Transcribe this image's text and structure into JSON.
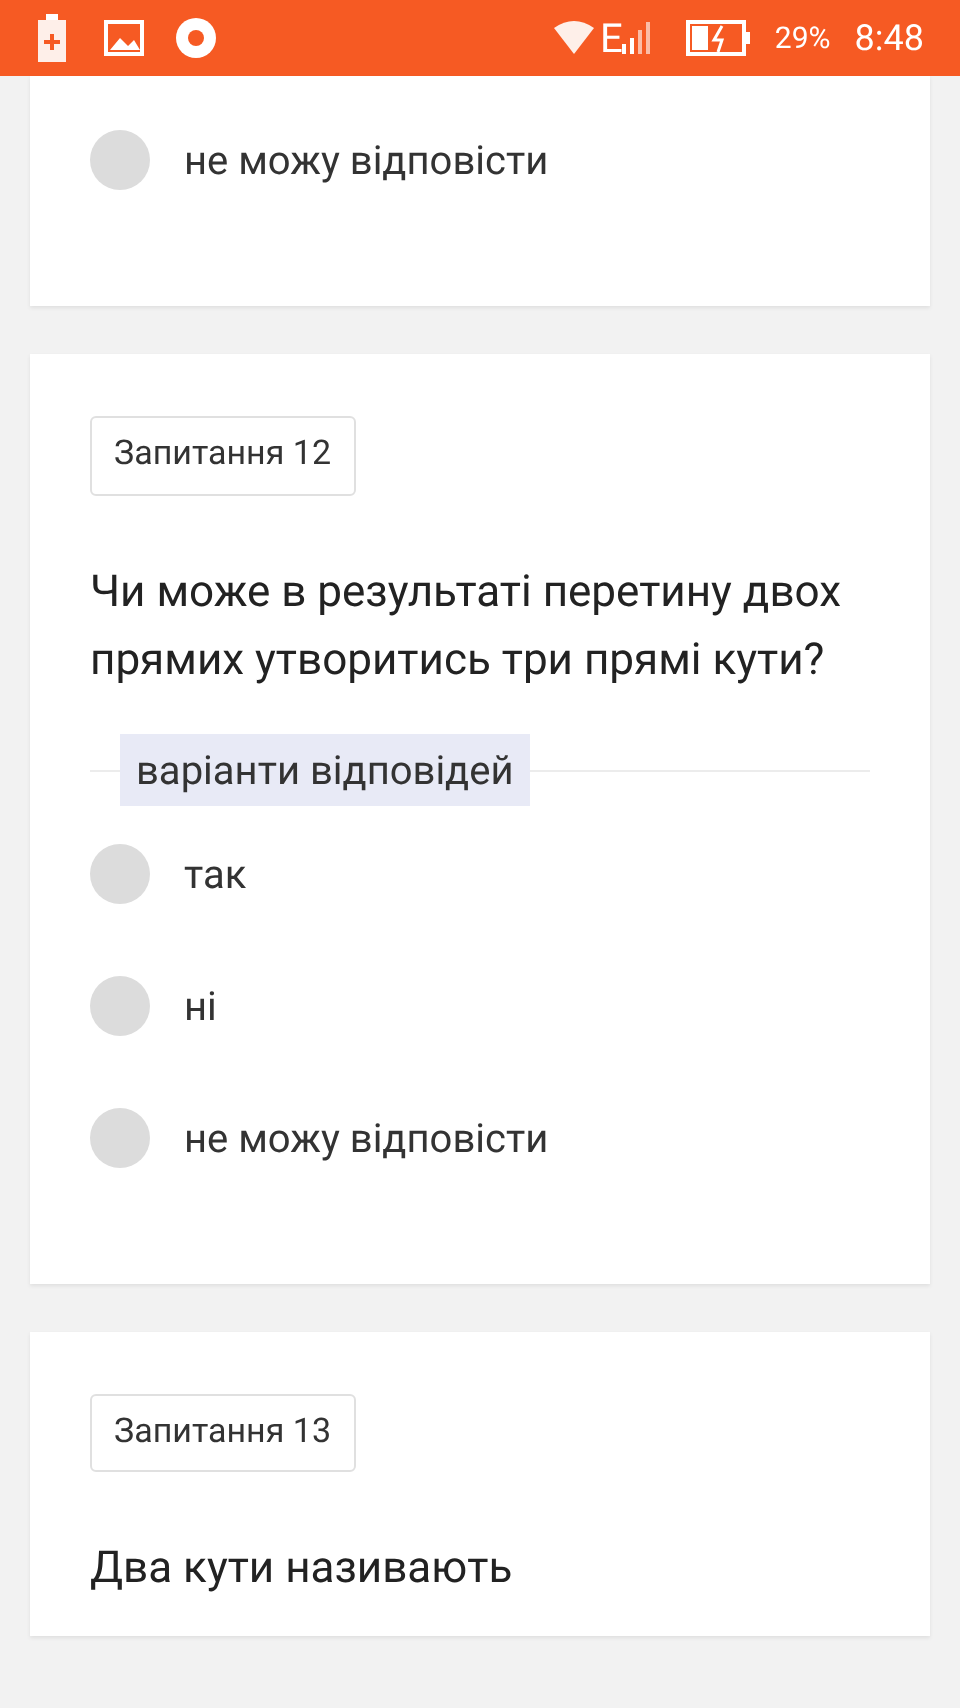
{
  "status_bar": {
    "network": "E",
    "battery": "29%",
    "time": "8:48"
  },
  "questions": [
    {
      "options": [
        {
          "label": "не можу відповісти",
          "selected": false
        }
      ]
    },
    {
      "tag": "Запитання 12",
      "text": "Чи може в результаті перетину двох прямих утворитись три прямі кути?",
      "options_heading": "варіанти відповідей",
      "options": [
        {
          "label": "так",
          "selected": false
        },
        {
          "label": "ні",
          "selected": false
        },
        {
          "label": "не можу відповісти",
          "selected": false
        }
      ]
    },
    {
      "tag": "Запитання 13",
      "text": "Два кути називають"
    }
  ]
}
